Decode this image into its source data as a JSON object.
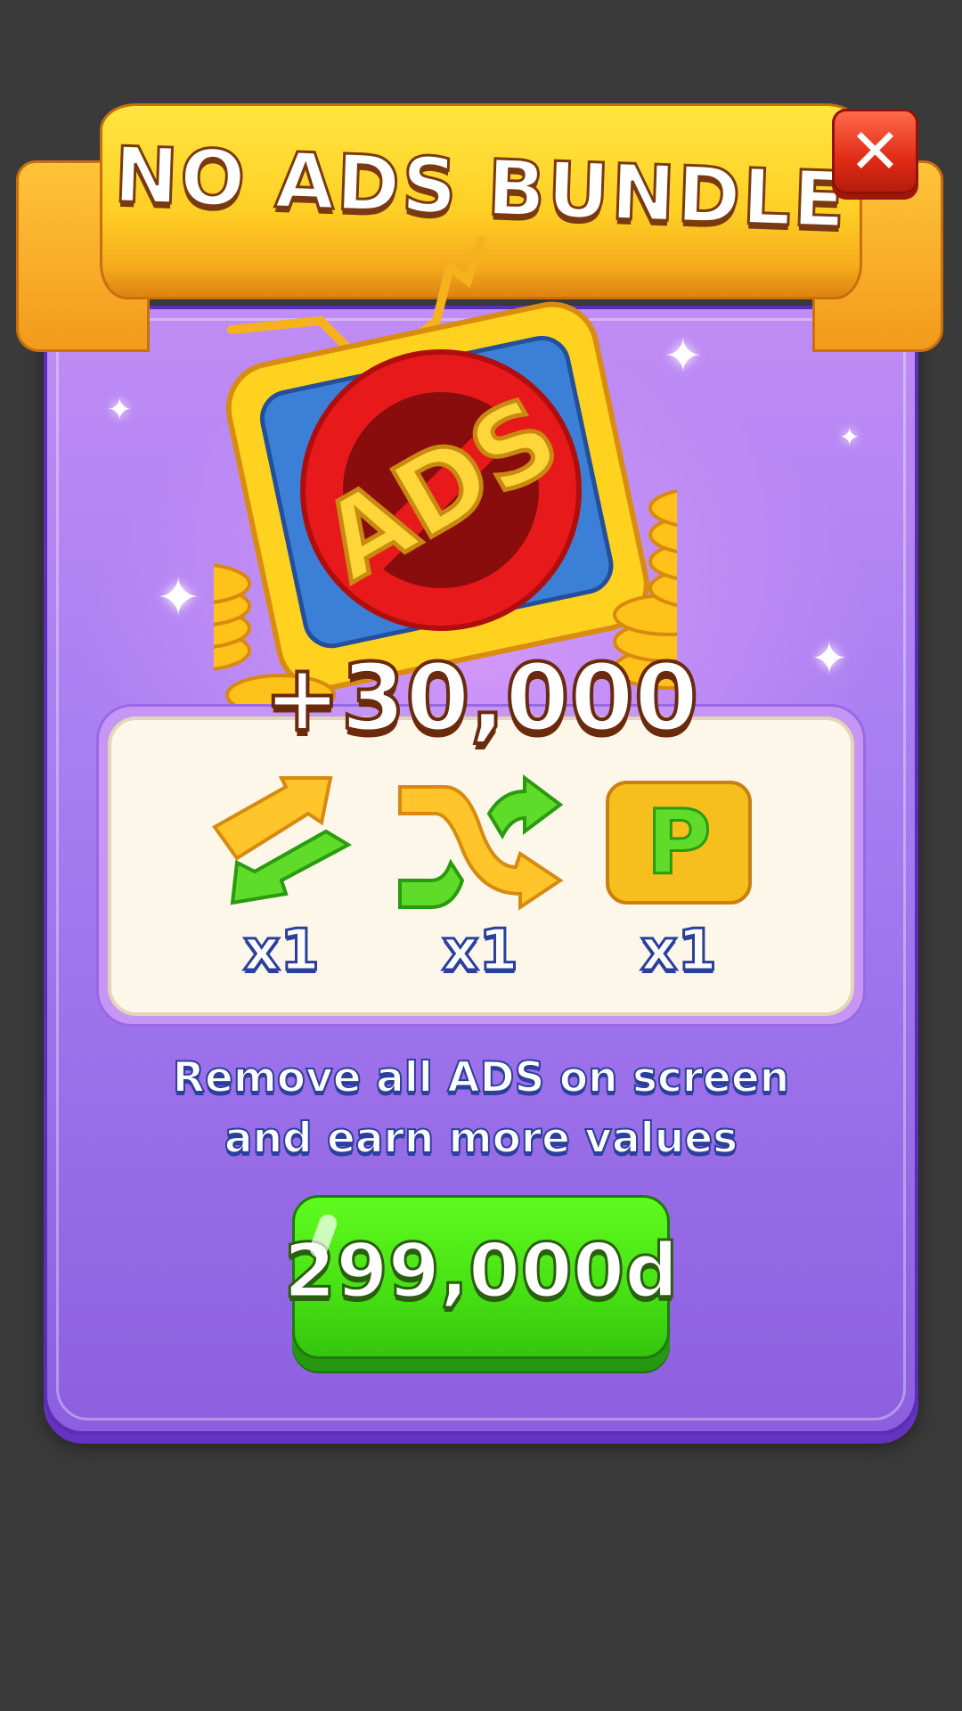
{
  "dialog": {
    "title": "NO ADS BUNDLE",
    "close_icon": "close-icon",
    "illustration": {
      "tv_label": "ADS"
    },
    "reward": "+30,000",
    "items": [
      {
        "icon": "swap-arrows-icon",
        "quantity": "x1"
      },
      {
        "icon": "shuffle-icon",
        "quantity": "x1"
      },
      {
        "icon": "p-block-icon",
        "quantity": "x1"
      }
    ],
    "description_line1": "Remove all ADS on screen",
    "description_line2": "and earn more values",
    "buy_button": {
      "label": "299,000d"
    },
    "colors": {
      "panel": "#a57cf0",
      "ribbon": "#ffcf25",
      "button": "#46e013",
      "close": "#e12b16"
    }
  }
}
